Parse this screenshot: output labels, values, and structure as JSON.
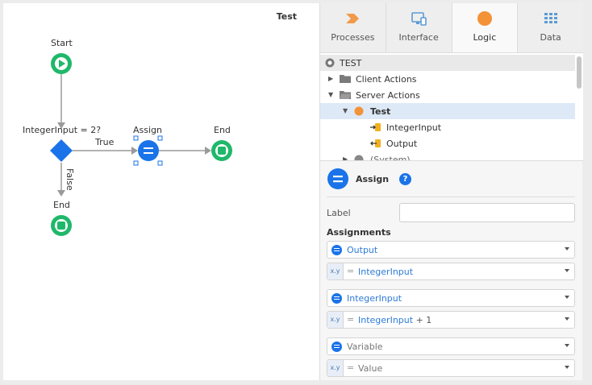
{
  "canvas": {
    "title": "Test",
    "nodes": {
      "start": "Start",
      "if": "IntegerInput = 2?",
      "assign": "Assign",
      "end_right": "End",
      "end_bottom": "End"
    },
    "connectors": {
      "true_label": "True",
      "false_label": "False"
    }
  },
  "tabs": [
    {
      "label": "Processes",
      "icon": "processes-icon",
      "color": "#f2994a"
    },
    {
      "label": "Interface",
      "icon": "interface-icon",
      "color": "#5b9bd5"
    },
    {
      "label": "Logic",
      "icon": "logic-icon",
      "color": "#f39237"
    },
    {
      "label": "Data",
      "icon": "data-icon",
      "color": "#5b9bd5"
    }
  ],
  "tree": {
    "root": "TEST",
    "client_actions": "Client Actions",
    "server_actions": "Server Actions",
    "action": "Test",
    "param_in": "IntegerInput",
    "param_out": "Output",
    "system": "(System)"
  },
  "properties": {
    "title": "Assign",
    "help": "?",
    "label_caption": "Label",
    "label_value": "",
    "assignments_caption": "Assignments",
    "assignments": [
      {
        "variable": "Output",
        "expr_left": "IntegerInput",
        "expr_right": ""
      },
      {
        "variable": "IntegerInput",
        "expr_left": "IntegerInput",
        "expr_right": "+ 1"
      },
      {
        "variable": "Variable",
        "expr_left": "Value",
        "expr_right": ""
      }
    ],
    "xy_badge": "x.y",
    "equals": "="
  },
  "colors": {
    "start_end": "#1fb86a",
    "decision": "#1a73e8",
    "assign": "#1a73e8",
    "connector": "#9a9a9a",
    "selected_row": "#dde9f7"
  }
}
